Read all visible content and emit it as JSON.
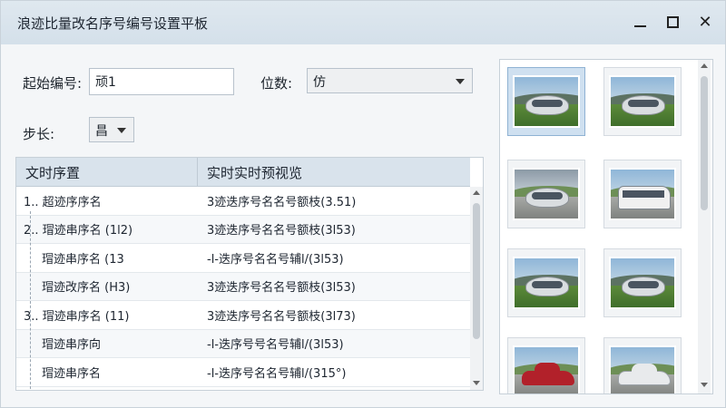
{
  "window": {
    "title": "浪迹比量改名序号编号设置平板",
    "controls": {
      "minimize_icon": "minimize-icon",
      "maximize_icon": "maximize-icon",
      "close_icon": "close-icon",
      "close_glyph": "✕"
    }
  },
  "form": {
    "start_label": "起始编号:",
    "start_value": "顽1",
    "digits_label": "位数:",
    "digits_value": "仿",
    "step_label": "步长:",
    "step_value": "昌"
  },
  "table": {
    "columns": [
      "文时序置",
      "实时实时预视览"
    ],
    "rows": [
      {
        "name": "1.. 超迹序序名",
        "preview": "3迹迭序号名名号额枝(3.51)"
      },
      {
        "name": "2.. 瑁迹串序名 (1l2)",
        "preview": "3迹迭序号名名号额枝(3l53)"
      },
      {
        "name": "瑁迹串序名 (13",
        "preview": "-l-迭序号名名号辅l/(3l53)"
      },
      {
        "name": "瑁迹改序名 (H3)",
        "preview": "3迹迭序号名名号额枝(3l53)"
      },
      {
        "name": "3.. 瑁迹串序名 (11)",
        "preview": "3迹迭序号名名号额枝(3l73)"
      },
      {
        "name": "瑁迹串序向",
        "preview": "-l-迭序号号名号辅l/(3l53)"
      },
      {
        "name": "瑁迹串序名",
        "preview": "-l-迭序号名名号辅l/(315°)"
      }
    ]
  },
  "gallery": {
    "items": [
      {
        "subject": "pod-car",
        "selected": true
      },
      {
        "subject": "pod-car",
        "selected": false
      },
      {
        "subject": "pod-car-road",
        "selected": false
      },
      {
        "subject": "bus",
        "selected": false
      },
      {
        "subject": "pod-car",
        "selected": false
      },
      {
        "subject": "pod-car",
        "selected": false
      },
      {
        "subject": "red-car",
        "selected": false
      },
      {
        "subject": "white-car",
        "selected": false
      }
    ]
  },
  "colors": {
    "titlebar": "#d4e0ea",
    "header_row": "#d9e3ec",
    "selected_thumb": "#cfe0f0",
    "red_car": "#b2212a",
    "white_car": "#e8eaec"
  }
}
